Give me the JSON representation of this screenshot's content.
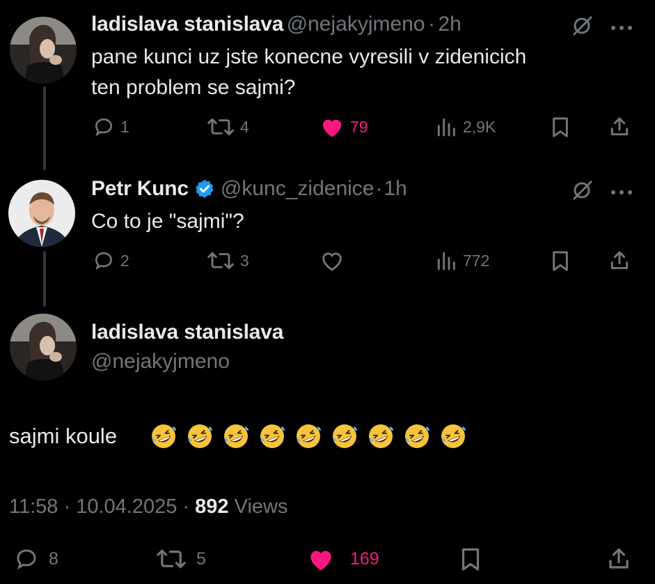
{
  "tweets": [
    {
      "name": "ladislava stanislava",
      "handle": "@nejakyjmeno",
      "dot": "·",
      "time": "2h",
      "text_line1": "pane kunci uz jste konecne vyresili v zidenicich",
      "text_line2": "ten problem se sajmi?",
      "replies": "1",
      "reposts": "4",
      "likes": "79",
      "views": "2,9K",
      "liked": true
    },
    {
      "name": "Petr Kunc",
      "handle": "@kunc_zidenice",
      "dot": "·",
      "time": "1h",
      "text_line1": "Co to je \"sajmi\"?",
      "replies": "2",
      "reposts": "3",
      "views": "772",
      "liked": false,
      "verified": true
    }
  ],
  "main_tweet": {
    "name": "ladislava stanislava",
    "handle": "@nejakyjmeno",
    "text": "sajmi koule",
    "emoji_count": 9,
    "emoji_name": "rolling-on-floor-laughing",
    "time": "11:58",
    "dot1": "·",
    "date": "10.04.2025",
    "dot2": "·",
    "views_count": "892",
    "views_label": "Views",
    "replies": "8",
    "reposts": "5",
    "likes": "169",
    "liked": true
  },
  "colors": {
    "background": "#000000",
    "text": "#e7e9ea",
    "muted": "#71767b",
    "like": "#f91880",
    "verified": "#1d9bf0",
    "thread_line": "#333639"
  }
}
